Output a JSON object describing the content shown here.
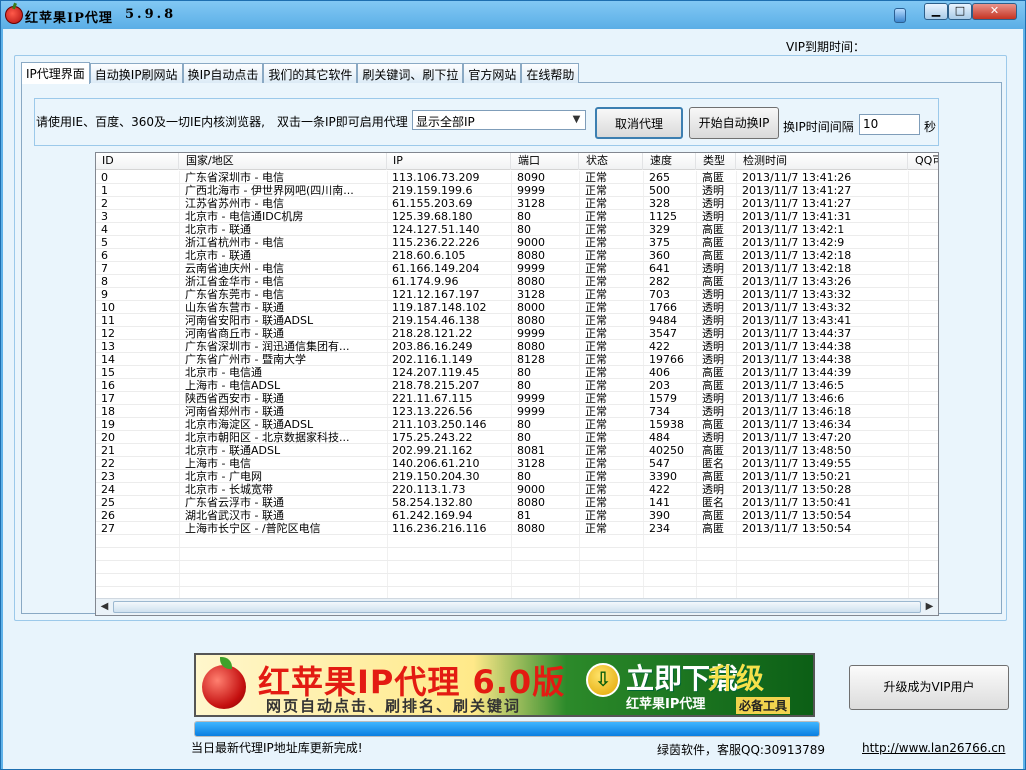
{
  "window": {
    "title": "红苹果IP代理",
    "version": "5.9.8",
    "controls": {
      "minimize": "▁",
      "maximize": "□",
      "close": "✕"
    }
  },
  "vip_expire_label": "VIP到期时间：",
  "tabs": [
    {
      "label": "IP代理界面",
      "active": true
    },
    {
      "label": "自动换IP刷网站"
    },
    {
      "label": "换IP自动点击"
    },
    {
      "label": "我们的其它软件"
    },
    {
      "label": "刷关键词、刷下拉"
    },
    {
      "label": "官方网站"
    },
    {
      "label": "在线帮助"
    }
  ],
  "options": {
    "hint": "请使用IE、百度、360及一切IE内核浏览器,　双击一条IP即可启用代理",
    "filter_value": "显示全部IP",
    "cancel_proxy": "取消代理",
    "auto_switch": "开始自动换IP",
    "interval_label": "换IP时间间隔",
    "interval_value": "10",
    "seconds": "秒"
  },
  "table": {
    "columns": [
      "ID",
      "国家/地区",
      "IP",
      "端口",
      "状态",
      "速度",
      "类型",
      "检测时间",
      "QQ可"
    ],
    "rows": [
      [
        "0",
        "广东省深圳市 - 电信",
        "113.106.73.209",
        "8090",
        "正常",
        "265",
        "高匿",
        "2013/11/7 13:41:26"
      ],
      [
        "1",
        "广西北海市 - 伊世界网吧(四川南...",
        "219.159.199.6",
        "9999",
        "正常",
        "500",
        "透明",
        "2013/11/7 13:41:27"
      ],
      [
        "2",
        "江苏省苏州市 - 电信",
        "61.155.203.69",
        "3128",
        "正常",
        "328",
        "透明",
        "2013/11/7 13:41:27"
      ],
      [
        "3",
        "北京市 - 电信通IDC机房",
        "125.39.68.180",
        "80",
        "正常",
        "1125",
        "透明",
        "2013/11/7 13:41:31"
      ],
      [
        "4",
        "北京市 - 联通",
        "124.127.51.140",
        "80",
        "正常",
        "329",
        "高匿",
        "2013/11/7 13:42:1"
      ],
      [
        "5",
        "浙江省杭州市 - 电信",
        "115.236.22.226",
        "9000",
        "正常",
        "375",
        "高匿",
        "2013/11/7 13:42:9"
      ],
      [
        "6",
        "北京市 - 联通",
        "218.60.6.105",
        "8080",
        "正常",
        "360",
        "高匿",
        "2013/11/7 13:42:18"
      ],
      [
        "7",
        "云南省迪庆州 - 电信",
        "61.166.149.204",
        "9999",
        "正常",
        "641",
        "透明",
        "2013/11/7 13:42:18"
      ],
      [
        "8",
        "浙江省金华市 - 电信",
        "61.174.9.96",
        "8080",
        "正常",
        "282",
        "高匿",
        "2013/11/7 13:43:26"
      ],
      [
        "9",
        "广东省东莞市 - 电信",
        "121.12.167.197",
        "3128",
        "正常",
        "703",
        "透明",
        "2013/11/7 13:43:32"
      ],
      [
        "10",
        "山东省东营市 - 联通",
        "119.187.148.102",
        "8000",
        "正常",
        "1766",
        "透明",
        "2013/11/7 13:43:32"
      ],
      [
        "11",
        "河南省安阳市 - 联通ADSL",
        "219.154.46.138",
        "8080",
        "正常",
        "9484",
        "透明",
        "2013/11/7 13:43:41"
      ],
      [
        "12",
        "河南省商丘市 - 联通",
        "218.28.121.22",
        "9999",
        "正常",
        "3547",
        "透明",
        "2013/11/7 13:44:37"
      ],
      [
        "13",
        "广东省深圳市 - 润迅通信集团有...",
        "203.86.16.249",
        "8080",
        "正常",
        "422",
        "透明",
        "2013/11/7 13:44:38"
      ],
      [
        "14",
        "广东省广州市 - 暨南大学",
        "202.116.1.149",
        "8128",
        "正常",
        "19766",
        "透明",
        "2013/11/7 13:44:38"
      ],
      [
        "15",
        "北京市 - 电信通",
        "124.207.119.45",
        "80",
        "正常",
        "406",
        "高匿",
        "2013/11/7 13:44:39"
      ],
      [
        "16",
        "上海市 - 电信ADSL",
        "218.78.215.207",
        "80",
        "正常",
        "203",
        "高匿",
        "2013/11/7 13:46:5"
      ],
      [
        "17",
        "陕西省西安市 - 联通",
        "221.11.67.115",
        "9999",
        "正常",
        "1579",
        "透明",
        "2013/11/7 13:46:6"
      ],
      [
        "18",
        "河南省郑州市 - 联通",
        "123.13.226.56",
        "9999",
        "正常",
        "734",
        "透明",
        "2013/11/7 13:46:18"
      ],
      [
        "19",
        "北京市海淀区 - 联通ADSL",
        "211.103.250.146",
        "80",
        "正常",
        "15938",
        "高匿",
        "2013/11/7 13:46:34"
      ],
      [
        "20",
        "北京市朝阳区 - 北京数据家科技...",
        "175.25.243.22",
        "80",
        "正常",
        "484",
        "透明",
        "2013/11/7 13:47:20"
      ],
      [
        "21",
        "北京市 - 联通ADSL",
        "202.99.21.162",
        "8081",
        "正常",
        "40250",
        "高匿",
        "2013/11/7 13:48:50"
      ],
      [
        "22",
        "上海市 - 电信",
        "140.206.61.210",
        "3128",
        "正常",
        "547",
        "匿名",
        "2013/11/7 13:49:55"
      ],
      [
        "23",
        "北京市 - 广电网",
        "219.150.204.30",
        "80",
        "正常",
        "3390",
        "高匿",
        "2013/11/7 13:50:21"
      ],
      [
        "24",
        "北京市 - 长城宽带",
        "220.113.1.73",
        "9000",
        "正常",
        "422",
        "透明",
        "2013/11/7 13:50:28"
      ],
      [
        "25",
        "广东省云浮市 - 联通",
        "58.254.132.80",
        "8080",
        "正常",
        "141",
        "匿名",
        "2013/11/7 13:50:41"
      ],
      [
        "26",
        "湖北省武汉市 - 联通",
        "61.242.169.94",
        "81",
        "正常",
        "390",
        "高匿",
        "2013/11/7 13:50:54"
      ],
      [
        "27",
        "上海市长宁区 - /普陀区电信",
        "116.236.216.116",
        "8080",
        "正常",
        "234",
        "高匿",
        "2013/11/7 13:50:54"
      ]
    ]
  },
  "banner": {
    "title": "红苹果IP代理 6.0版",
    "subtitle": "网页自动点击、刷排名、刷关键词",
    "cta": "立即下载",
    "cta_overlay": "升级",
    "cta_line2": "红苹果IP代理",
    "tag": "必备工具"
  },
  "upgrade_button": "升级成为VIP用户",
  "progress": {
    "value": 1.0
  },
  "status": "当日最新代理IP地址库更新完成!",
  "company": "绿茵软件，客服QQ:30913789",
  "website": "http://www.lan26766.cn"
}
